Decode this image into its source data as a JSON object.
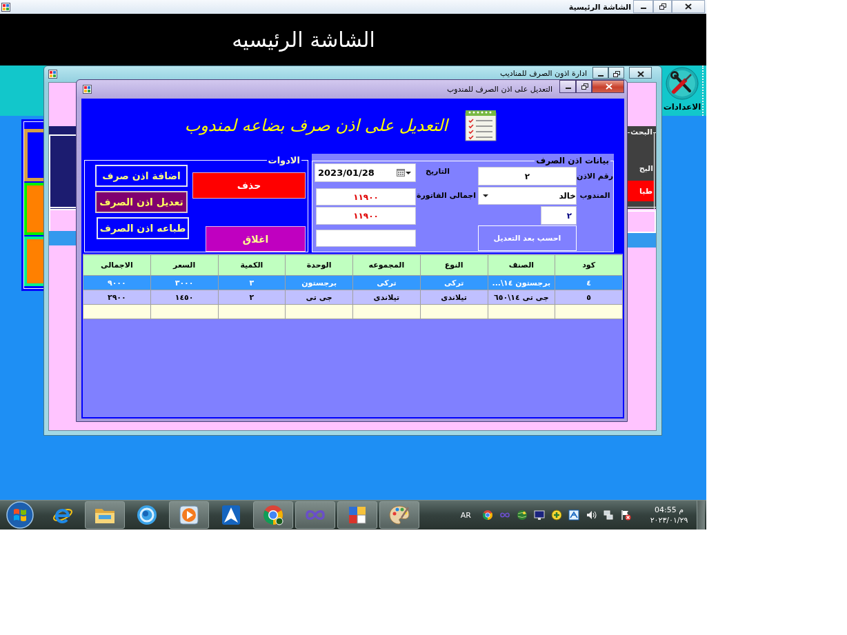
{
  "main_window": {
    "title": "الشاشة الرئيسية",
    "header": "الشاشة الرئيسيه",
    "settings_label": "الاعدادات"
  },
  "manager_window": {
    "title": "ادارة اذون الصرف للمناديب",
    "search_panel": {
      "title": "البحث",
      "label": "البح",
      "button": "طبا"
    }
  },
  "dialog": {
    "title": "التعديل على اذن الصرف للمندوب",
    "heading": "التعديل على اذن صرف بضاعه لمندوب",
    "tools": {
      "title": "الادوات",
      "buttons": [
        {
          "label": "اضافة اذن صرف",
          "kind": "add"
        },
        {
          "label": "تعديل اذن الصرف",
          "kind": "edit"
        },
        {
          "label": "طباعه اذن الصرف",
          "kind": "print"
        },
        {
          "label": "حذف",
          "kind": "delete"
        },
        {
          "label": "اغلاق",
          "kind": "close"
        }
      ]
    },
    "details": {
      "title": "بيانات اذن الصرف",
      "permit_number": {
        "label": "رقم الاذن",
        "value": "٢"
      },
      "date": {
        "label": "التاريخ",
        "value": "2023/01/28"
      },
      "representative": {
        "label": "المندوب",
        "value": "خالد"
      },
      "invoice_total": {
        "label": "اجمالى الفاتورة",
        "value": "١١٩٠٠"
      },
      "second_total": "١١٩٠٠",
      "short_field": "٢",
      "recalculate_button": "احسب بعد التعديل"
    },
    "table": {
      "columns": [
        "كود",
        "الصنف",
        "النوع",
        "المجموعه",
        "الوحدة",
        "الكمية",
        "السعر",
        "الاجمالى"
      ],
      "rows": [
        {
          "cells": [
            "٤",
            "برجستون ١٤\\...",
            "تركى",
            "تركى",
            "برجستون",
            "٣",
            "٣٠٠٠",
            "٩٠٠٠"
          ],
          "selected": true
        },
        {
          "cells": [
            "٥",
            "جى تى ١٤\\٦٥٠",
            "تيلاندى",
            "تيلاندى",
            "جى تى",
            "٢",
            "١٤٥٠",
            "٢٩٠٠"
          ],
          "selected": false
        }
      ],
      "new_row": true
    }
  },
  "taskbar": {
    "apps": [
      {
        "kind": "web",
        "running": false
      },
      {
        "kind": "folder",
        "running": true
      },
      {
        "kind": "swirl",
        "running": false
      },
      {
        "kind": "player",
        "running": true
      },
      {
        "kind": "letter",
        "running": false
      },
      {
        "kind": "wheel",
        "running": true
      },
      {
        "kind": "loop",
        "running": true
      },
      {
        "kind": "panel",
        "running": true
      },
      {
        "kind": "palette",
        "running": true
      }
    ],
    "language": "AR",
    "time": "04:55 م",
    "date": "٢٠٢٣/٠١/٢٩"
  }
}
